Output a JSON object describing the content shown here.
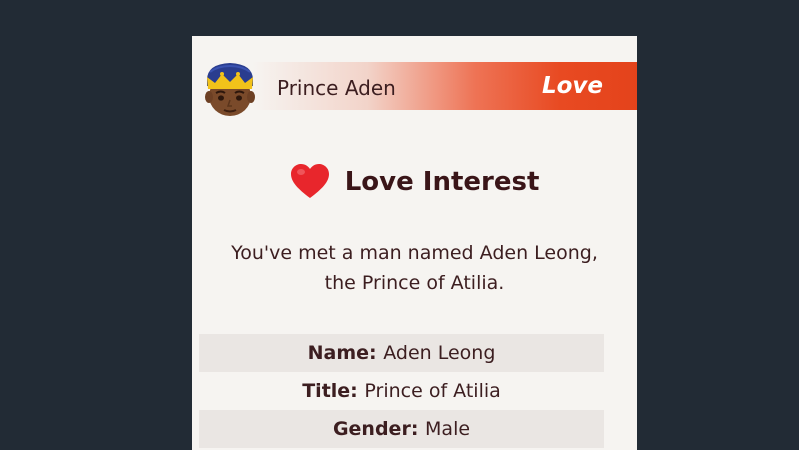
{
  "header": {
    "name": "Prince Aden",
    "relationship_tag": "Love",
    "avatar_icon": "crowned-man-avatar-icon",
    "bar_color": "#e4431b"
  },
  "event": {
    "icon": "heart-icon",
    "heart_color": "#e8262c",
    "title": "Love Interest",
    "message_line1": "You've met a man named Aden Leong,",
    "message_line2": "the Prince of Atilia."
  },
  "details": [
    {
      "key": "Name:",
      "value": "Aden Leong"
    },
    {
      "key": "Title:",
      "value": "Prince of Atilia"
    },
    {
      "key": "Gender:",
      "value": "Male"
    }
  ]
}
